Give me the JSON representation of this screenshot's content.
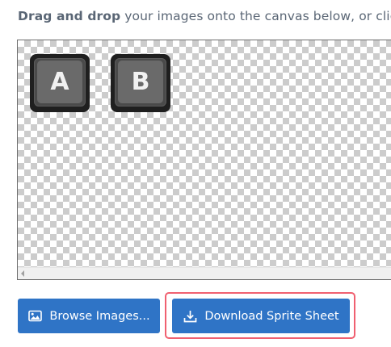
{
  "instruction": {
    "bold_text": "Drag and drop",
    "rest_text": " your images onto the canvas below, or click t"
  },
  "canvas": {
    "sprites": [
      {
        "label": "A"
      },
      {
        "label": "B"
      }
    ]
  },
  "buttons": {
    "browse_label": "Browse Images...",
    "browse_icon": "image-icon",
    "download_label": "Download Sprite Sheet",
    "download_icon": "download-icon"
  },
  "colors": {
    "button_bg": "#2f74c6",
    "highlight_border": "#f06070",
    "instruction_text": "#5a6675"
  }
}
